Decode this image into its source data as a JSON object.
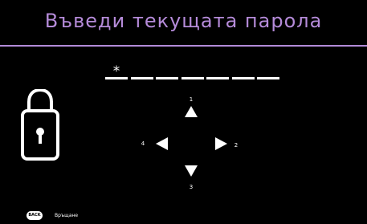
{
  "title": "Въведи текущата парола",
  "password": {
    "slots": [
      "*",
      "",
      "",
      "",
      "",
      "",
      ""
    ]
  },
  "dpad": {
    "up_number": "1",
    "right_number": "2",
    "down_number": "3",
    "left_number": "4"
  },
  "footer": {
    "back_badge": "BACK",
    "back_label": "Връщане"
  },
  "colors": {
    "background": "#000000",
    "title_text": "#b58bd9",
    "title_rule": "#b18ad8",
    "foreground": "#ffffff"
  },
  "icons": {
    "lock": "lock-icon",
    "up": "arrow-up-icon",
    "right": "arrow-right-icon",
    "down": "arrow-down-icon",
    "left": "arrow-left-icon"
  }
}
